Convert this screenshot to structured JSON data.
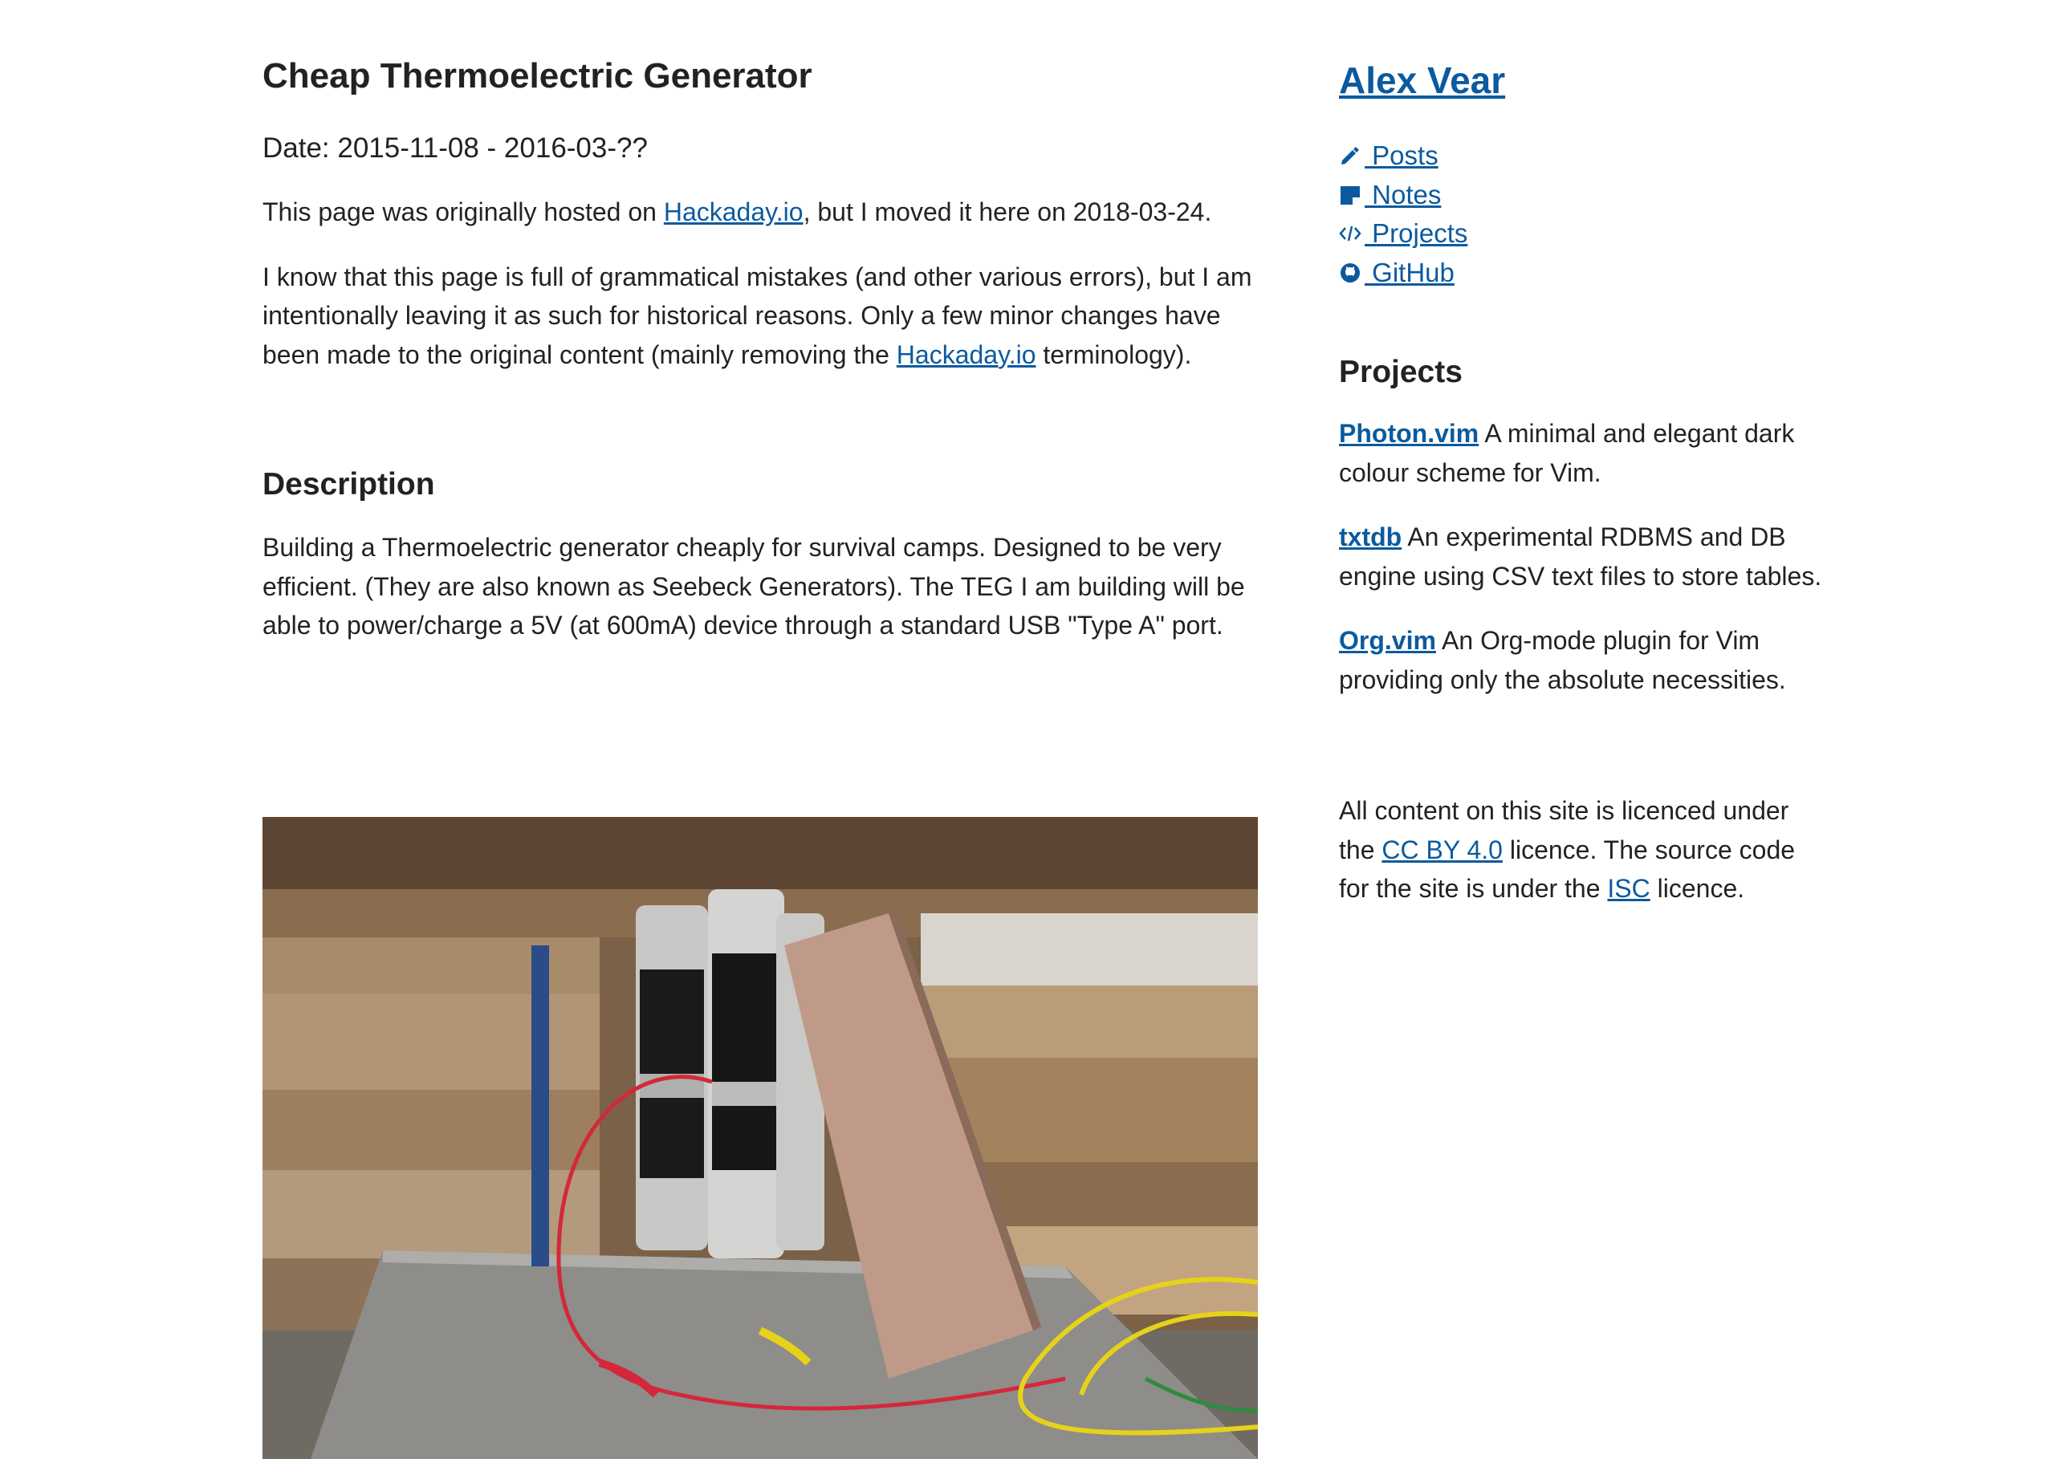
{
  "post": {
    "title": "Cheap Thermoelectric Generator",
    "date": "Date: 2015-11-08 - 2016-03-??",
    "intro": {
      "text_before": "This page was originally hosted on ",
      "link": "Hackaday.io",
      "text_after": ", but I moved it here on 2018-03-24."
    },
    "disclaimer": {
      "text_before": "I know that this page is full of grammatical mistakes (and other various errors), but I am intentionally leaving it as such for historical reasons. Only a few minor changes have been made to the original content (mainly removing the ",
      "link": "Hackaday.io",
      "text_after": " terminology)."
    },
    "description_heading": "Description",
    "description": "Building a Thermoelectric generator cheaply for survival camps. Designed to be very efficient. (They are also known as Seebeck Generators). The TEG I am building will be able to power/charge a 5V (at 600mA) device through a standard USB \"Type A\" port."
  },
  "sidebar": {
    "site_title": "Alex Vear",
    "nav": [
      {
        "label": " Posts",
        "icon": "pencil-icon"
      },
      {
        "label": " Notes",
        "icon": "note-icon"
      },
      {
        "label": " Projects",
        "icon": "code-icon"
      },
      {
        "label": " GitHub",
        "icon": "github-icon"
      }
    ],
    "projects_heading": "Projects",
    "projects": [
      {
        "name": "Photon.vim",
        "desc": " A minimal and elegant dark colour scheme for Vim."
      },
      {
        "name": "txtdb",
        "desc": " An experimental RDBMS and DB engine using CSV text files to store tables."
      },
      {
        "name": "Org.vim",
        "desc": " An Org-mode plugin for Vim providing only the absolute necessities."
      }
    ],
    "licence": {
      "text1": "All content on this site is licenced under the ",
      "link1": "CC BY 4.0",
      "text2": " licence. The source code for the site is under the ",
      "link2": "ISC",
      "text3": " licence."
    }
  },
  "colors": {
    "link": "#0b5a9e",
    "text": "#222222"
  }
}
